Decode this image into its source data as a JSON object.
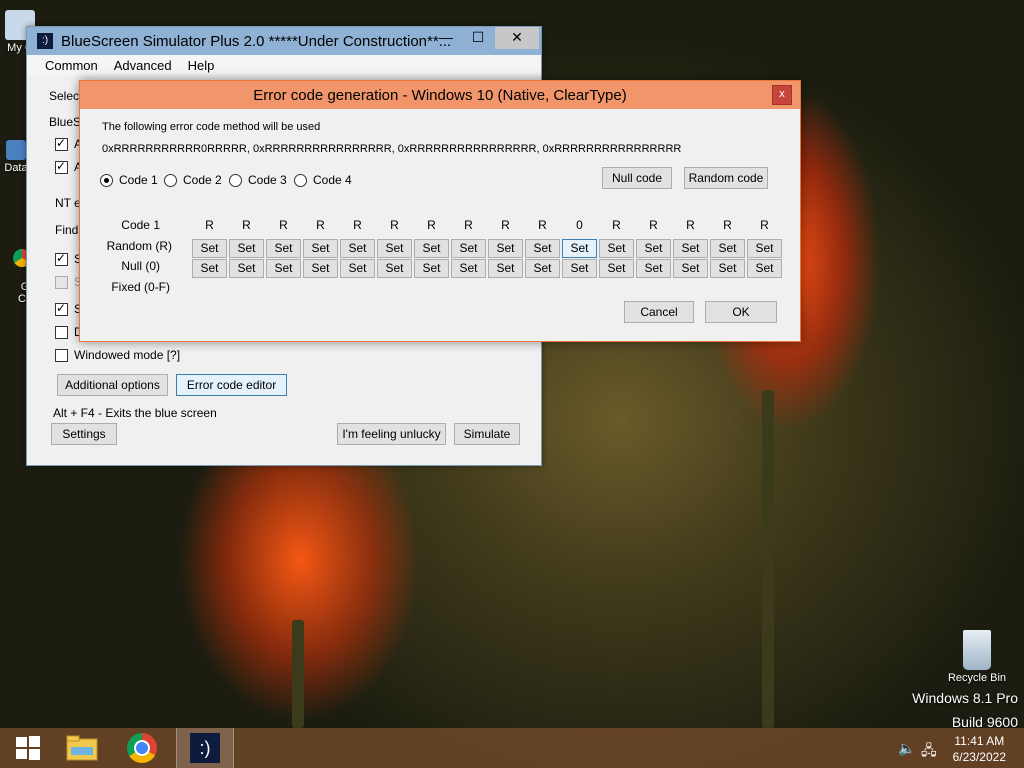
{
  "desktop": {
    "icons": [
      {
        "label": "My C"
      },
      {
        "label": "Data"
      },
      {
        "label": "G\nC"
      }
    ],
    "recycle_bin": "Recycle Bin",
    "watermark_line1": "Windows 8.1 Pro",
    "watermark_line2": "Build 9600"
  },
  "main_window": {
    "title": "BlueScreen Simulator Plus 2.0 *****Under Construction**...",
    "app_icon_text": ":)",
    "minimize": "—",
    "maximize": "☐",
    "close": "✕",
    "menu": [
      "Common",
      "Advanced",
      "Help"
    ],
    "select_label": "Select",
    "bluescreen_label": "BlueSc",
    "row_a1": "A",
    "row_a2": "A",
    "nt_label": "NT e",
    "find_label": "Find",
    "row_s1": "S",
    "row_s2": "S",
    "row_s3": "S",
    "row_d": "D",
    "windowed_mode": "Windowed mode [?]",
    "additional_options": "Additional options",
    "error_code_editor": "Error code editor",
    "alt_f4": "Alt + F4 - Exits the blue screen",
    "settings": "Settings",
    "feeling_unlucky": "I'm feeling unlucky",
    "simulate": "Simulate"
  },
  "dialog": {
    "title": "Error code generation - Windows 10 (Native, ClearType)",
    "close": "x",
    "method_label": "The following error code method will be used",
    "method_value": "0xRRRRRRRRRRR0RRRRR, 0xRRRRRRRRRRRRRRRR, 0xRRRRRRRRRRRRRRRR, 0xRRRRRRRRRRRRRRRR",
    "radios": [
      {
        "label": "Code 1",
        "selected": true
      },
      {
        "label": "Code 2",
        "selected": false
      },
      {
        "label": "Code 3",
        "selected": false
      },
      {
        "label": "Code 4",
        "selected": false
      }
    ],
    "null_code": "Null code",
    "random_code": "Random code",
    "row_labels": {
      "code": "Code 1",
      "random": "Random (R)",
      "null": "Null (0)",
      "fixed": "Fixed (0-F)"
    },
    "columns": [
      "R",
      "R",
      "R",
      "R",
      "R",
      "R",
      "R",
      "R",
      "R",
      "R",
      "0",
      "R",
      "R",
      "R",
      "R",
      "R"
    ],
    "set_label": "Set",
    "highlighted_column": 10,
    "cancel": "Cancel",
    "ok": "OK"
  },
  "taskbar": {
    "time": "11:41 AM",
    "date": "6/23/2022",
    "app_icon_text": ":)"
  }
}
